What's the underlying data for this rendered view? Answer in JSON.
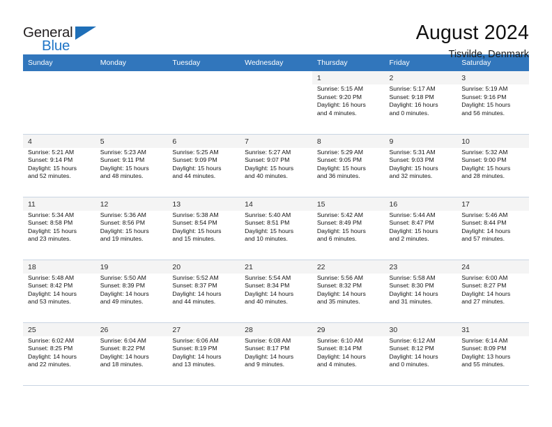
{
  "brand": {
    "name_top": "General",
    "name_bottom": "Blue",
    "accent_color": "#2176c7",
    "triangle_color": "#1f6fb8"
  },
  "header": {
    "title": "August 2024",
    "subtitle": "Tisvilde, Denmark"
  },
  "calendar": {
    "header_bg": "#3176bc",
    "weekday_headers": [
      "Sunday",
      "Monday",
      "Tuesday",
      "Wednesday",
      "Thursday",
      "Friday",
      "Saturday"
    ],
    "weeks": [
      [
        {
          "day": "",
          "lines": []
        },
        {
          "day": "",
          "lines": []
        },
        {
          "day": "",
          "lines": []
        },
        {
          "day": "",
          "lines": []
        },
        {
          "day": "1",
          "lines": [
            "Sunrise: 5:15 AM",
            "Sunset: 9:20 PM",
            "Daylight: 16 hours",
            "and 4 minutes."
          ]
        },
        {
          "day": "2",
          "lines": [
            "Sunrise: 5:17 AM",
            "Sunset: 9:18 PM",
            "Daylight: 16 hours",
            "and 0 minutes."
          ]
        },
        {
          "day": "3",
          "lines": [
            "Sunrise: 5:19 AM",
            "Sunset: 9:16 PM",
            "Daylight: 15 hours",
            "and 56 minutes."
          ]
        }
      ],
      [
        {
          "day": "4",
          "lines": [
            "Sunrise: 5:21 AM",
            "Sunset: 9:14 PM",
            "Daylight: 15 hours",
            "and 52 minutes."
          ]
        },
        {
          "day": "5",
          "lines": [
            "Sunrise: 5:23 AM",
            "Sunset: 9:11 PM",
            "Daylight: 15 hours",
            "and 48 minutes."
          ]
        },
        {
          "day": "6",
          "lines": [
            "Sunrise: 5:25 AM",
            "Sunset: 9:09 PM",
            "Daylight: 15 hours",
            "and 44 minutes."
          ]
        },
        {
          "day": "7",
          "lines": [
            "Sunrise: 5:27 AM",
            "Sunset: 9:07 PM",
            "Daylight: 15 hours",
            "and 40 minutes."
          ]
        },
        {
          "day": "8",
          "lines": [
            "Sunrise: 5:29 AM",
            "Sunset: 9:05 PM",
            "Daylight: 15 hours",
            "and 36 minutes."
          ]
        },
        {
          "day": "9",
          "lines": [
            "Sunrise: 5:31 AM",
            "Sunset: 9:03 PM",
            "Daylight: 15 hours",
            "and 32 minutes."
          ]
        },
        {
          "day": "10",
          "lines": [
            "Sunrise: 5:32 AM",
            "Sunset: 9:00 PM",
            "Daylight: 15 hours",
            "and 28 minutes."
          ]
        }
      ],
      [
        {
          "day": "11",
          "lines": [
            "Sunrise: 5:34 AM",
            "Sunset: 8:58 PM",
            "Daylight: 15 hours",
            "and 23 minutes."
          ]
        },
        {
          "day": "12",
          "lines": [
            "Sunrise: 5:36 AM",
            "Sunset: 8:56 PM",
            "Daylight: 15 hours",
            "and 19 minutes."
          ]
        },
        {
          "day": "13",
          "lines": [
            "Sunrise: 5:38 AM",
            "Sunset: 8:54 PM",
            "Daylight: 15 hours",
            "and 15 minutes."
          ]
        },
        {
          "day": "14",
          "lines": [
            "Sunrise: 5:40 AM",
            "Sunset: 8:51 PM",
            "Daylight: 15 hours",
            "and 10 minutes."
          ]
        },
        {
          "day": "15",
          "lines": [
            "Sunrise: 5:42 AM",
            "Sunset: 8:49 PM",
            "Daylight: 15 hours",
            "and 6 minutes."
          ]
        },
        {
          "day": "16",
          "lines": [
            "Sunrise: 5:44 AM",
            "Sunset: 8:47 PM",
            "Daylight: 15 hours",
            "and 2 minutes."
          ]
        },
        {
          "day": "17",
          "lines": [
            "Sunrise: 5:46 AM",
            "Sunset: 8:44 PM",
            "Daylight: 14 hours",
            "and 57 minutes."
          ]
        }
      ],
      [
        {
          "day": "18",
          "lines": [
            "Sunrise: 5:48 AM",
            "Sunset: 8:42 PM",
            "Daylight: 14 hours",
            "and 53 minutes."
          ]
        },
        {
          "day": "19",
          "lines": [
            "Sunrise: 5:50 AM",
            "Sunset: 8:39 PM",
            "Daylight: 14 hours",
            "and 49 minutes."
          ]
        },
        {
          "day": "20",
          "lines": [
            "Sunrise: 5:52 AM",
            "Sunset: 8:37 PM",
            "Daylight: 14 hours",
            "and 44 minutes."
          ]
        },
        {
          "day": "21",
          "lines": [
            "Sunrise: 5:54 AM",
            "Sunset: 8:34 PM",
            "Daylight: 14 hours",
            "and 40 minutes."
          ]
        },
        {
          "day": "22",
          "lines": [
            "Sunrise: 5:56 AM",
            "Sunset: 8:32 PM",
            "Daylight: 14 hours",
            "and 35 minutes."
          ]
        },
        {
          "day": "23",
          "lines": [
            "Sunrise: 5:58 AM",
            "Sunset: 8:30 PM",
            "Daylight: 14 hours",
            "and 31 minutes."
          ]
        },
        {
          "day": "24",
          "lines": [
            "Sunrise: 6:00 AM",
            "Sunset: 8:27 PM",
            "Daylight: 14 hours",
            "and 27 minutes."
          ]
        }
      ],
      [
        {
          "day": "25",
          "lines": [
            "Sunrise: 6:02 AM",
            "Sunset: 8:25 PM",
            "Daylight: 14 hours",
            "and 22 minutes."
          ]
        },
        {
          "day": "26",
          "lines": [
            "Sunrise: 6:04 AM",
            "Sunset: 8:22 PM",
            "Daylight: 14 hours",
            "and 18 minutes."
          ]
        },
        {
          "day": "27",
          "lines": [
            "Sunrise: 6:06 AM",
            "Sunset: 8:19 PM",
            "Daylight: 14 hours",
            "and 13 minutes."
          ]
        },
        {
          "day": "28",
          "lines": [
            "Sunrise: 6:08 AM",
            "Sunset: 8:17 PM",
            "Daylight: 14 hours",
            "and 9 minutes."
          ]
        },
        {
          "day": "29",
          "lines": [
            "Sunrise: 6:10 AM",
            "Sunset: 8:14 PM",
            "Daylight: 14 hours",
            "and 4 minutes."
          ]
        },
        {
          "day": "30",
          "lines": [
            "Sunrise: 6:12 AM",
            "Sunset: 8:12 PM",
            "Daylight: 14 hours",
            "and 0 minutes."
          ]
        },
        {
          "day": "31",
          "lines": [
            "Sunrise: 6:14 AM",
            "Sunset: 8:09 PM",
            "Daylight: 13 hours",
            "and 55 minutes."
          ]
        }
      ]
    ]
  }
}
